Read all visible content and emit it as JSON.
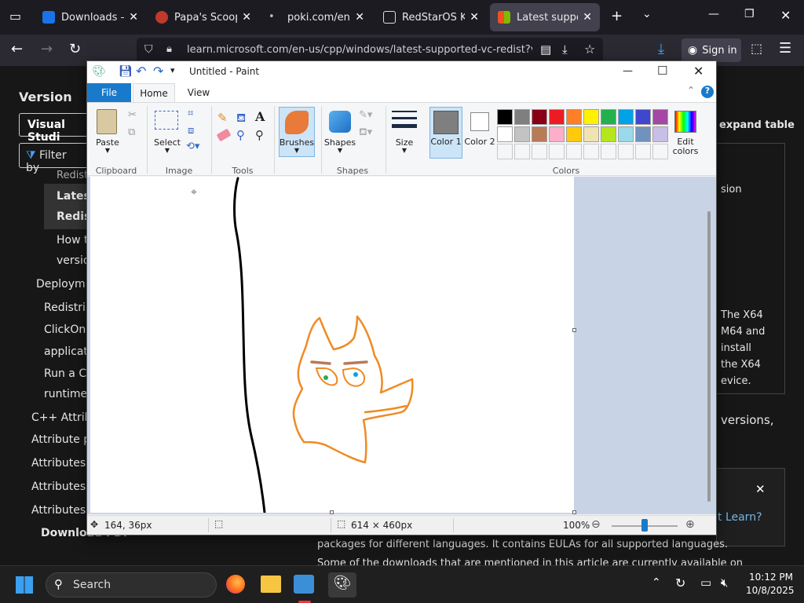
{
  "browser": {
    "tabs": [
      {
        "title": "Downloads – Or",
        "favcolor": "#1a73e8"
      },
      {
        "title": "Papa's Scooperi",
        "favcolor": "#c0392b"
      },
      {
        "title": "poki.com/en/g/p",
        "favcolor": "#bbbbbb"
      },
      {
        "title": "RedStarOS Korea",
        "favcolor": "#dddddd"
      },
      {
        "title": "Latest supported",
        "favcolor": "#f25022"
      }
    ],
    "url": "learn.microsoft.com/en-us/cpp/windows/latest-supported-vc-redist?vie",
    "sign_in": "Sign in"
  },
  "page": {
    "sidebar_heading": "Version",
    "version_select": "Visual Studi",
    "filter_placeholder": "Filter by",
    "items": [
      "Redist",
      "Latest",
      "Redist",
      "How t",
      "versio",
      "Deploym",
      "Redistrib",
      "ClickOnc",
      "applicati",
      "Run a C+",
      "runtime",
      "C++ Attribu",
      "Attribute pr",
      "Attributes b",
      "Attributes b",
      "Attributes a",
      "Download PDF"
    ],
    "right_text": [
      "expand table",
      "sion",
      "The X64",
      "M64 and",
      "install",
      "the X64",
      "evice.",
      "versions,",
      "t Learn?"
    ],
    "bottom_text": [
      "packages for different languages. It contains EULAs for all supported languages.",
      "Some of the downloads that are mentioned in this article are currently available on"
    ]
  },
  "paint": {
    "title": "Untitled - Paint",
    "tabs": {
      "file": "File",
      "home": "Home",
      "view": "View"
    },
    "groups": {
      "clipboard": "Clipboard",
      "image": "Image",
      "tools": "Tools",
      "shapes": "Shapes",
      "colors": "Colors"
    },
    "buttons": {
      "paste": "Paste",
      "select": "Select",
      "brushes": "Brushes",
      "shapes": "Shapes",
      "size": "Size",
      "color1": "Color 1",
      "color2": "Color 2",
      "edit_colors": "Edit colors"
    },
    "colors": {
      "row1": [
        "#000000",
        "#7f7f7f",
        "#880015",
        "#ed1c24",
        "#ff7f27",
        "#fff200",
        "#22b14c",
        "#00a2e8",
        "#3f48cc",
        "#a349a4"
      ],
      "row2": [
        "#ffffff",
        "#c3c3c3",
        "#b97a57",
        "#ffaec9",
        "#ffc90e",
        "#efe4b0",
        "#b5e61d",
        "#99d9ea",
        "#7092be",
        "#c8bfe7"
      ],
      "color1": "#7f7f7f",
      "color2": "#ffffff"
    },
    "status": {
      "cursor": "164, 36px",
      "size": "614 × 460px",
      "zoom": "100%"
    }
  },
  "taskbar": {
    "search": "Search",
    "time": "10:12 PM",
    "date": "10/8/2025"
  }
}
